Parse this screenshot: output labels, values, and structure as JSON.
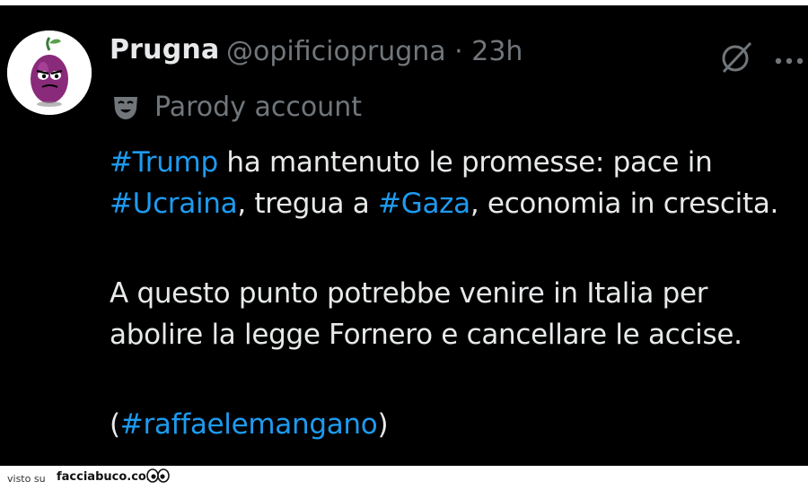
{
  "post": {
    "display_name": "Prugna",
    "handle_time": "@opificioprugna · 23h",
    "badge_label": "Parody account",
    "lines": [
      {
        "segments": [
          {
            "text": "#Trump",
            "hashtag": true
          },
          {
            "text": " ha mantenuto le promesse: pace in",
            "hashtag": false
          }
        ]
      },
      {
        "segments": [
          {
            "text": "#Ucraina",
            "hashtag": true
          },
          {
            "text": ", tregua a ",
            "hashtag": false
          },
          {
            "text": "#Gaza",
            "hashtag": true
          },
          {
            "text": ", economia in crescita.",
            "hashtag": false
          }
        ]
      },
      {
        "segments": []
      },
      {
        "segments": [
          {
            "text": "A questo punto potrebbe venire in Italia per",
            "hashtag": false
          }
        ]
      },
      {
        "segments": [
          {
            "text": "abolire la legge Fornero e cancellare le accise.",
            "hashtag": false
          }
        ]
      },
      {
        "segments": []
      },
      {
        "segments": [
          {
            "text": "(",
            "hashtag": false
          },
          {
            "text": "#raffaelemangano",
            "hashtag": true
          },
          {
            "text": ")",
            "hashtag": false
          }
        ]
      }
    ]
  },
  "icons": {
    "avatar": "plum-avatar",
    "grok": "grok-icon",
    "more": "more-icon",
    "parody": "theater-mask-icon"
  },
  "colors": {
    "background": "#000000",
    "text": "#e7e9ea",
    "muted": "#71767b",
    "hashtag": "#1d9bf0"
  },
  "footer": {
    "visto_su": "visto su",
    "brand": "facciabuco.com"
  }
}
